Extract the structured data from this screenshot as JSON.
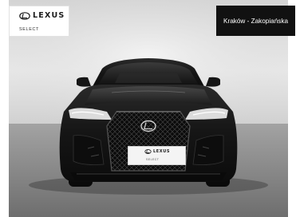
{
  "brand": {
    "wordmark": "LEXUS",
    "program": "SELECT",
    "icon": "lexus-emblem-icon"
  },
  "dealer": {
    "location": "Kraków - Zakopiańska"
  },
  "license_plate": {
    "brand": "LEXUS",
    "program": "SELECT"
  },
  "colors": {
    "car_body": "#151515",
    "dealer_box": "#111111",
    "studio_wall": "#dcdcdc",
    "floor": "#8a8a8a"
  }
}
